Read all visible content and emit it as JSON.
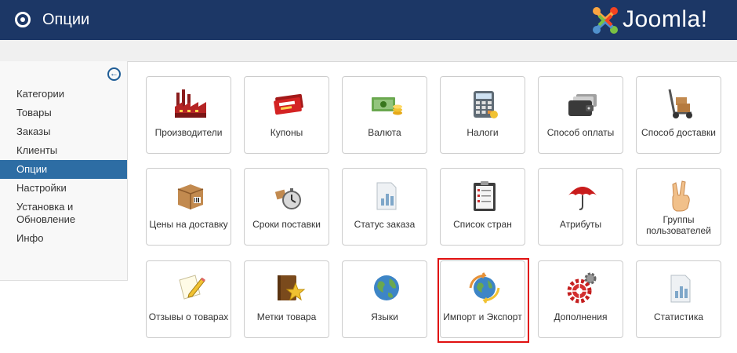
{
  "header": {
    "title": "Опции",
    "logo_text": "Joomla!"
  },
  "sidebar": {
    "collapse_icon": "arrow-left-circle-icon",
    "items": [
      {
        "label": "Категории"
      },
      {
        "label": "Товары"
      },
      {
        "label": "Заказы"
      },
      {
        "label": "Клиенты"
      },
      {
        "label": "Опции",
        "active": true
      },
      {
        "label": "Настройки"
      },
      {
        "label": "Установка и\nОбновление"
      },
      {
        "label": "Инфо"
      }
    ]
  },
  "tiles": [
    {
      "label": "Производители",
      "icon": "factory-icon"
    },
    {
      "label": "Купоны",
      "icon": "coupon-icon"
    },
    {
      "label": "Валюта",
      "icon": "money-icon"
    },
    {
      "label": "Налоги",
      "icon": "calculator-icon"
    },
    {
      "label": "Способ оплаты",
      "icon": "wallet-cards-icon"
    },
    {
      "label": "Способ доставки",
      "icon": "hand-truck-icon"
    },
    {
      "label": "Цены на доставку",
      "icon": "box-icon"
    },
    {
      "label": "Сроки поставки",
      "icon": "stopwatch-box-icon"
    },
    {
      "label": "Статус заказа",
      "icon": "report-icon"
    },
    {
      "label": "Список стран",
      "icon": "clipboard-icon"
    },
    {
      "label": "Атрибуты",
      "icon": "umbrella-icon"
    },
    {
      "label": "Группы пользователей",
      "icon": "peace-hand-icon"
    },
    {
      "label": "Отзывы о товарах",
      "icon": "note-pencil-icon"
    },
    {
      "label": "Метки товара",
      "icon": "book-star-icon"
    },
    {
      "label": "Языки",
      "icon": "globe-icon"
    },
    {
      "label": "Импорт и Экспорт",
      "icon": "globe-arrows-icon",
      "highlighted": true
    },
    {
      "label": "Дополнения",
      "icon": "gears-icon"
    },
    {
      "label": "Статистика",
      "icon": "stats-icon"
    }
  ],
  "colors": {
    "header_bg": "#1c3766",
    "active_nav": "#2d6da4",
    "highlight": "#e01010"
  }
}
